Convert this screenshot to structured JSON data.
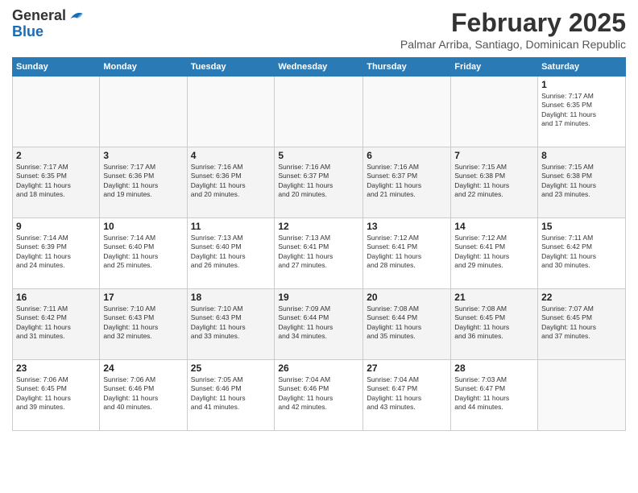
{
  "header": {
    "logo_general": "General",
    "logo_blue": "Blue",
    "month_title": "February 2025",
    "subtitle": "Palmar Arriba, Santiago, Dominican Republic"
  },
  "weekdays": [
    "Sunday",
    "Monday",
    "Tuesday",
    "Wednesday",
    "Thursday",
    "Friday",
    "Saturday"
  ],
  "weeks": [
    [
      {
        "day": "",
        "info": ""
      },
      {
        "day": "",
        "info": ""
      },
      {
        "day": "",
        "info": ""
      },
      {
        "day": "",
        "info": ""
      },
      {
        "day": "",
        "info": ""
      },
      {
        "day": "",
        "info": ""
      },
      {
        "day": "1",
        "info": "Sunrise: 7:17 AM\nSunset: 6:35 PM\nDaylight: 11 hours\nand 17 minutes."
      }
    ],
    [
      {
        "day": "2",
        "info": "Sunrise: 7:17 AM\nSunset: 6:35 PM\nDaylight: 11 hours\nand 18 minutes."
      },
      {
        "day": "3",
        "info": "Sunrise: 7:17 AM\nSunset: 6:36 PM\nDaylight: 11 hours\nand 19 minutes."
      },
      {
        "day": "4",
        "info": "Sunrise: 7:16 AM\nSunset: 6:36 PM\nDaylight: 11 hours\nand 20 minutes."
      },
      {
        "day": "5",
        "info": "Sunrise: 7:16 AM\nSunset: 6:37 PM\nDaylight: 11 hours\nand 20 minutes."
      },
      {
        "day": "6",
        "info": "Sunrise: 7:16 AM\nSunset: 6:37 PM\nDaylight: 11 hours\nand 21 minutes."
      },
      {
        "day": "7",
        "info": "Sunrise: 7:15 AM\nSunset: 6:38 PM\nDaylight: 11 hours\nand 22 minutes."
      },
      {
        "day": "8",
        "info": "Sunrise: 7:15 AM\nSunset: 6:38 PM\nDaylight: 11 hours\nand 23 minutes."
      }
    ],
    [
      {
        "day": "9",
        "info": "Sunrise: 7:14 AM\nSunset: 6:39 PM\nDaylight: 11 hours\nand 24 minutes."
      },
      {
        "day": "10",
        "info": "Sunrise: 7:14 AM\nSunset: 6:40 PM\nDaylight: 11 hours\nand 25 minutes."
      },
      {
        "day": "11",
        "info": "Sunrise: 7:13 AM\nSunset: 6:40 PM\nDaylight: 11 hours\nand 26 minutes."
      },
      {
        "day": "12",
        "info": "Sunrise: 7:13 AM\nSunset: 6:41 PM\nDaylight: 11 hours\nand 27 minutes."
      },
      {
        "day": "13",
        "info": "Sunrise: 7:12 AM\nSunset: 6:41 PM\nDaylight: 11 hours\nand 28 minutes."
      },
      {
        "day": "14",
        "info": "Sunrise: 7:12 AM\nSunset: 6:41 PM\nDaylight: 11 hours\nand 29 minutes."
      },
      {
        "day": "15",
        "info": "Sunrise: 7:11 AM\nSunset: 6:42 PM\nDaylight: 11 hours\nand 30 minutes."
      }
    ],
    [
      {
        "day": "16",
        "info": "Sunrise: 7:11 AM\nSunset: 6:42 PM\nDaylight: 11 hours\nand 31 minutes."
      },
      {
        "day": "17",
        "info": "Sunrise: 7:10 AM\nSunset: 6:43 PM\nDaylight: 11 hours\nand 32 minutes."
      },
      {
        "day": "18",
        "info": "Sunrise: 7:10 AM\nSunset: 6:43 PM\nDaylight: 11 hours\nand 33 minutes."
      },
      {
        "day": "19",
        "info": "Sunrise: 7:09 AM\nSunset: 6:44 PM\nDaylight: 11 hours\nand 34 minutes."
      },
      {
        "day": "20",
        "info": "Sunrise: 7:08 AM\nSunset: 6:44 PM\nDaylight: 11 hours\nand 35 minutes."
      },
      {
        "day": "21",
        "info": "Sunrise: 7:08 AM\nSunset: 6:45 PM\nDaylight: 11 hours\nand 36 minutes."
      },
      {
        "day": "22",
        "info": "Sunrise: 7:07 AM\nSunset: 6:45 PM\nDaylight: 11 hours\nand 37 minutes."
      }
    ],
    [
      {
        "day": "23",
        "info": "Sunrise: 7:06 AM\nSunset: 6:45 PM\nDaylight: 11 hours\nand 39 minutes."
      },
      {
        "day": "24",
        "info": "Sunrise: 7:06 AM\nSunset: 6:46 PM\nDaylight: 11 hours\nand 40 minutes."
      },
      {
        "day": "25",
        "info": "Sunrise: 7:05 AM\nSunset: 6:46 PM\nDaylight: 11 hours\nand 41 minutes."
      },
      {
        "day": "26",
        "info": "Sunrise: 7:04 AM\nSunset: 6:46 PM\nDaylight: 11 hours\nand 42 minutes."
      },
      {
        "day": "27",
        "info": "Sunrise: 7:04 AM\nSunset: 6:47 PM\nDaylight: 11 hours\nand 43 minutes."
      },
      {
        "day": "28",
        "info": "Sunrise: 7:03 AM\nSunset: 6:47 PM\nDaylight: 11 hours\nand 44 minutes."
      },
      {
        "day": "",
        "info": ""
      }
    ]
  ]
}
